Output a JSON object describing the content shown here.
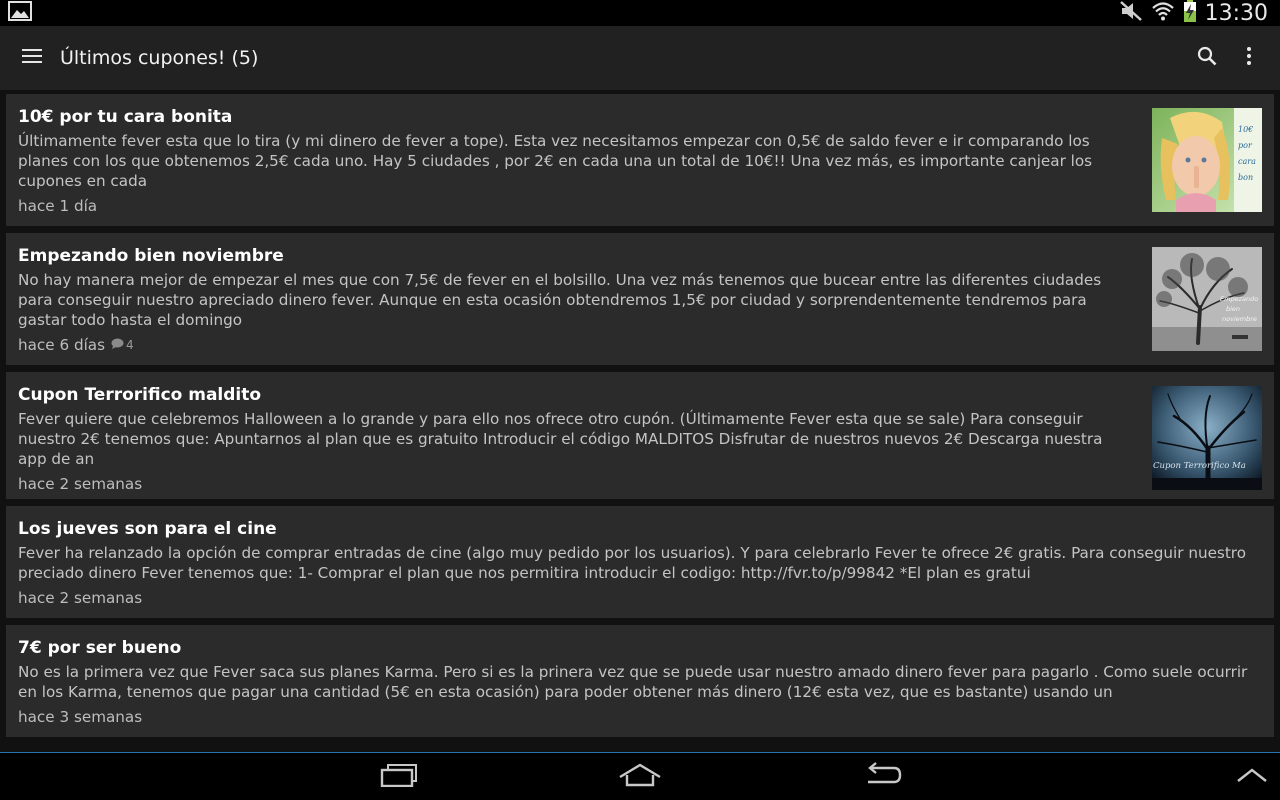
{
  "status_bar": {
    "time": "13:30",
    "icons": [
      "gallery-icon",
      "mute-icon",
      "wifi-icon",
      "battery-charging-icon"
    ]
  },
  "action_bar": {
    "title": "Últimos cupones! (5)",
    "icons": [
      "menu-icon",
      "search-icon",
      "overflow-menu-icon"
    ]
  },
  "cards": [
    {
      "title": "10€ por tu cara bonita",
      "body": "Últimamente fever esta que lo tira (y mi dinero de fever a tope). Esta vez necesitamos empezar con 0,5€ de saldo fever e ir comparando los planes con los que obtenemos 2,5€ cada uno. Hay 5 ciudades , por 2€ en cada una un total de 10€!! Una vez más, es importante canjear los cupones en cada",
      "meta": "hace 1 día",
      "thumb_text": "10€ por tu cara bon"
    },
    {
      "title": "Empezando bien noviembre",
      "body": "No hay manera mejor de empezar el mes que con 7,5€ de fever en el bolsillo. Una vez más tenemos que bucear entre las diferentes ciudades para conseguir nuestro apreciado dinero fever. Aunque en esta ocasión obtendremos 1,5€ por ciudad y sorprendentemente tendremos para gastar todo hasta el domingo",
      "meta": "hace 6 días",
      "comments": "4",
      "thumb_text": "Empezando bien noviembre"
    },
    {
      "title": "Cupon Terrorifico maldito",
      "body": "Fever quiere que celebremos Halloween a lo grande y para ello nos ofrece otro cupón. (Últimamente Fever esta que se sale) Para conseguir nuestro 2€ tenemos que: Apuntarnos al plan  que es gratuito Introducir el código MALDITOS Disfrutar de nuestros nuevos 2€ Descarga nuestra app de an",
      "meta": "hace 2 semanas",
      "thumb_text": "Cupon Terrorifico Ma"
    },
    {
      "title": "Los jueves son para el cine",
      "body": "Fever ha relanzado la opción de comprar entradas de cine (algo muy pedido por los usuarios). Y para celebrarlo Fever te ofrece 2€ gratis. Para conseguir nuestro preciado dinero Fever tenemos que: 1- Comprar el plan que nos permitira introducir el codigo: http://fvr.to/p/99842 *El plan es gratui",
      "meta": "hace 2 semanas"
    },
    {
      "title": "7€ por ser bueno",
      "body": "No es la primera vez que Fever saca sus planes Karma. Pero si es la prinera vez que se puede usar nuestro amado dinero fever para pagarlo . Como suele ocurrir en los Karma, tenemos que pagar una cantidad (5€ en esta ocasión) para poder obtener más dinero (12€ esta vez, que es bastante) usando un",
      "meta": "hace 3 semanas"
    }
  ],
  "nav_bar": {
    "icons": [
      "recent-apps-icon",
      "home-icon",
      "back-icon",
      "expand-up-icon"
    ]
  }
}
